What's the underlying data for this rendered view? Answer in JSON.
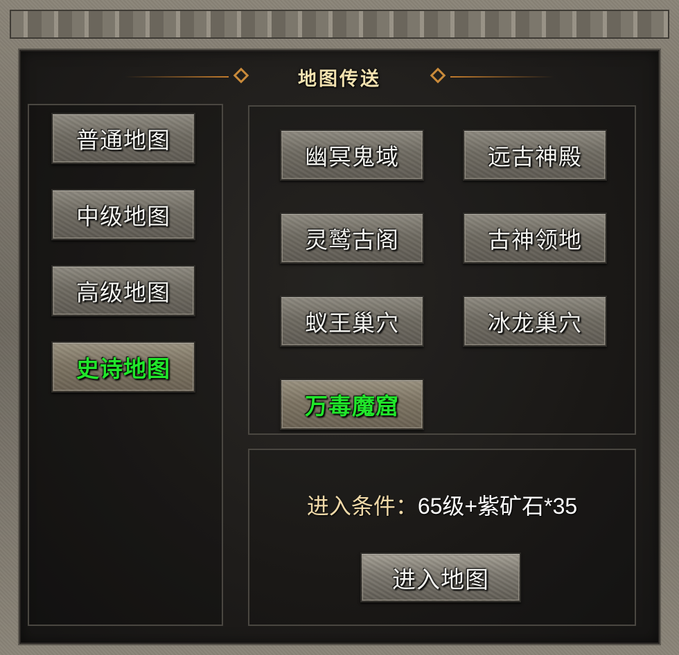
{
  "title": "地图传送",
  "categories": [
    {
      "label": "普通地图",
      "selected": false
    },
    {
      "label": "中级地图",
      "selected": false
    },
    {
      "label": "高级地图",
      "selected": false
    },
    {
      "label": "史诗地图",
      "selected": true
    }
  ],
  "maps": [
    {
      "label": "幽冥鬼域",
      "selected": false
    },
    {
      "label": "远古神殿",
      "selected": false
    },
    {
      "label": "灵鹫古阁",
      "selected": false
    },
    {
      "label": "古神领地",
      "selected": false
    },
    {
      "label": "蚁王巢穴",
      "selected": false
    },
    {
      "label": "冰龙巢穴",
      "selected": false
    },
    {
      "label": "万毒魔窟",
      "selected": true
    }
  ],
  "requirement": {
    "label": "进入条件：",
    "value": "65级+紫矿石*35"
  },
  "enter_button_label": "进入地图",
  "colors": {
    "selected_text": "#21e62b",
    "normal_text": "#f2f2ee",
    "title_text": "#f3e2b0",
    "accent_line": "#c07a2c"
  }
}
